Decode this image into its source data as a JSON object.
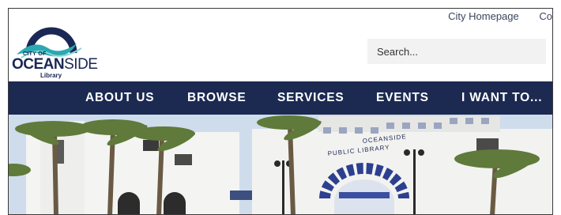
{
  "logo": {
    "line1": "CITY OF",
    "line2a": "OCEAN",
    "line2b": "SIDE",
    "line3": "Library"
  },
  "toplinks": {
    "city_homepage": "City Homepage",
    "truncated": "Co"
  },
  "search": {
    "placeholder": "Search..."
  },
  "nav": {
    "items": [
      "ABOUT US",
      "BROWSE",
      "SERVICES",
      "EVENTS",
      "I WANT TO..."
    ]
  },
  "hero": {
    "sign_line1": "OCEANSIDE",
    "sign_line2": "PUBLIC LIBRARY"
  },
  "colors": {
    "nav_bg": "#1c2a52",
    "logo_navy": "#1b2754",
    "logo_teal": "#2aa9b0"
  }
}
